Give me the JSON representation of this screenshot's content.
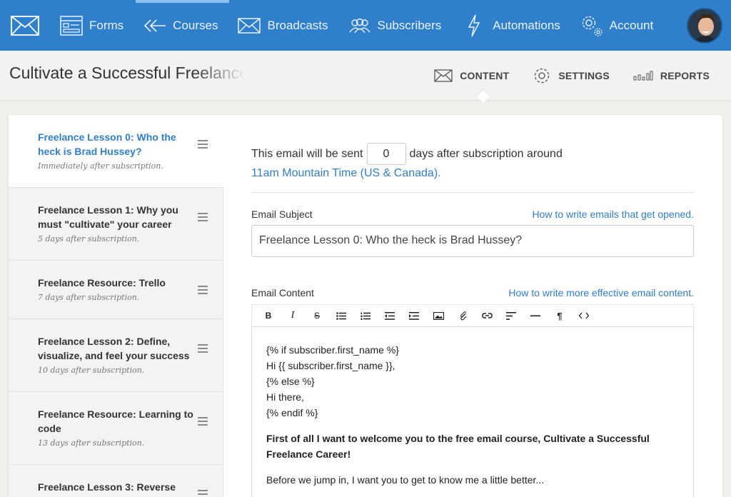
{
  "nav": {
    "items": [
      {
        "label": "Forms",
        "icon": "forms-icon"
      },
      {
        "label": "Courses",
        "icon": "courses-icon"
      },
      {
        "label": "Broadcasts",
        "icon": "broadcasts-icon"
      },
      {
        "label": "Subscribers",
        "icon": "subscribers-icon"
      },
      {
        "label": "Automations",
        "icon": "automations-icon"
      },
      {
        "label": "Account",
        "icon": "account-gear-icon"
      }
    ],
    "active": "Courses"
  },
  "page": {
    "title": "Cultivate a Successful Freelance Career",
    "tabs": [
      {
        "label": "CONTENT",
        "icon": "envelope-icon"
      },
      {
        "label": "SETTINGS",
        "icon": "gear-icon"
      },
      {
        "label": "REPORTS",
        "icon": "bar-chart-icon"
      }
    ]
  },
  "sidebar": {
    "items": [
      {
        "title": "Freelance Lesson 0: Who the heck is Brad Hussey?",
        "subtitle": "Immediately after subscription."
      },
      {
        "title": "Freelance Lesson 1: Why you must \"cultivate\" your career",
        "subtitle": "5 days after subscription."
      },
      {
        "title": "Freelance Resource: Trello",
        "subtitle": "7 days after subscription."
      },
      {
        "title": "Freelance Lesson 2: Define, visualize, and feel your success",
        "subtitle": "10 days after subscription."
      },
      {
        "title": "Freelance Resource: Learning to code",
        "subtitle": "13 days after subscription."
      },
      {
        "title": "Freelance Lesson 3: Reverse",
        "subtitle": ""
      }
    ]
  },
  "email": {
    "send_prefix": "This email will be sent",
    "days_value": "0",
    "send_suffix": "days after subscription around",
    "send_time": "11am Mountain Time (US & Canada).",
    "subject_label": "Email Subject",
    "subject_help": "How to write emails that get opened.",
    "subject_value": "Freelance Lesson 0: Who the heck is Brad Hussey?",
    "content_label": "Email Content",
    "content_help": "How to write more effective email content.",
    "toolbar": [
      "B",
      "I",
      "S",
      "bulleted-list-icon",
      "numbered-list-icon",
      "outdent-icon",
      "indent-icon",
      "image-icon",
      "attachment-icon",
      "link-icon",
      "align-icon",
      "horizontal-rule-icon",
      "paragraph-icon",
      "code-icon"
    ],
    "body": {
      "line1": "{% if subscriber.first_name %}",
      "line2": "Hi {{ subscriber.first_name }},",
      "line3": "{% else %}",
      "line4": "Hi there,",
      "line5": "{% endif %}",
      "bold1": "First of all I want to welcome you to the free email course, Cultivate a Successful Freelance Career!",
      "para1": "Before we jump in, I want you to get to know me a little better..."
    }
  },
  "colors": {
    "nav_bg": "#2f7fcb",
    "link": "#2f7fcb",
    "page_bg": "#f1efec"
  }
}
